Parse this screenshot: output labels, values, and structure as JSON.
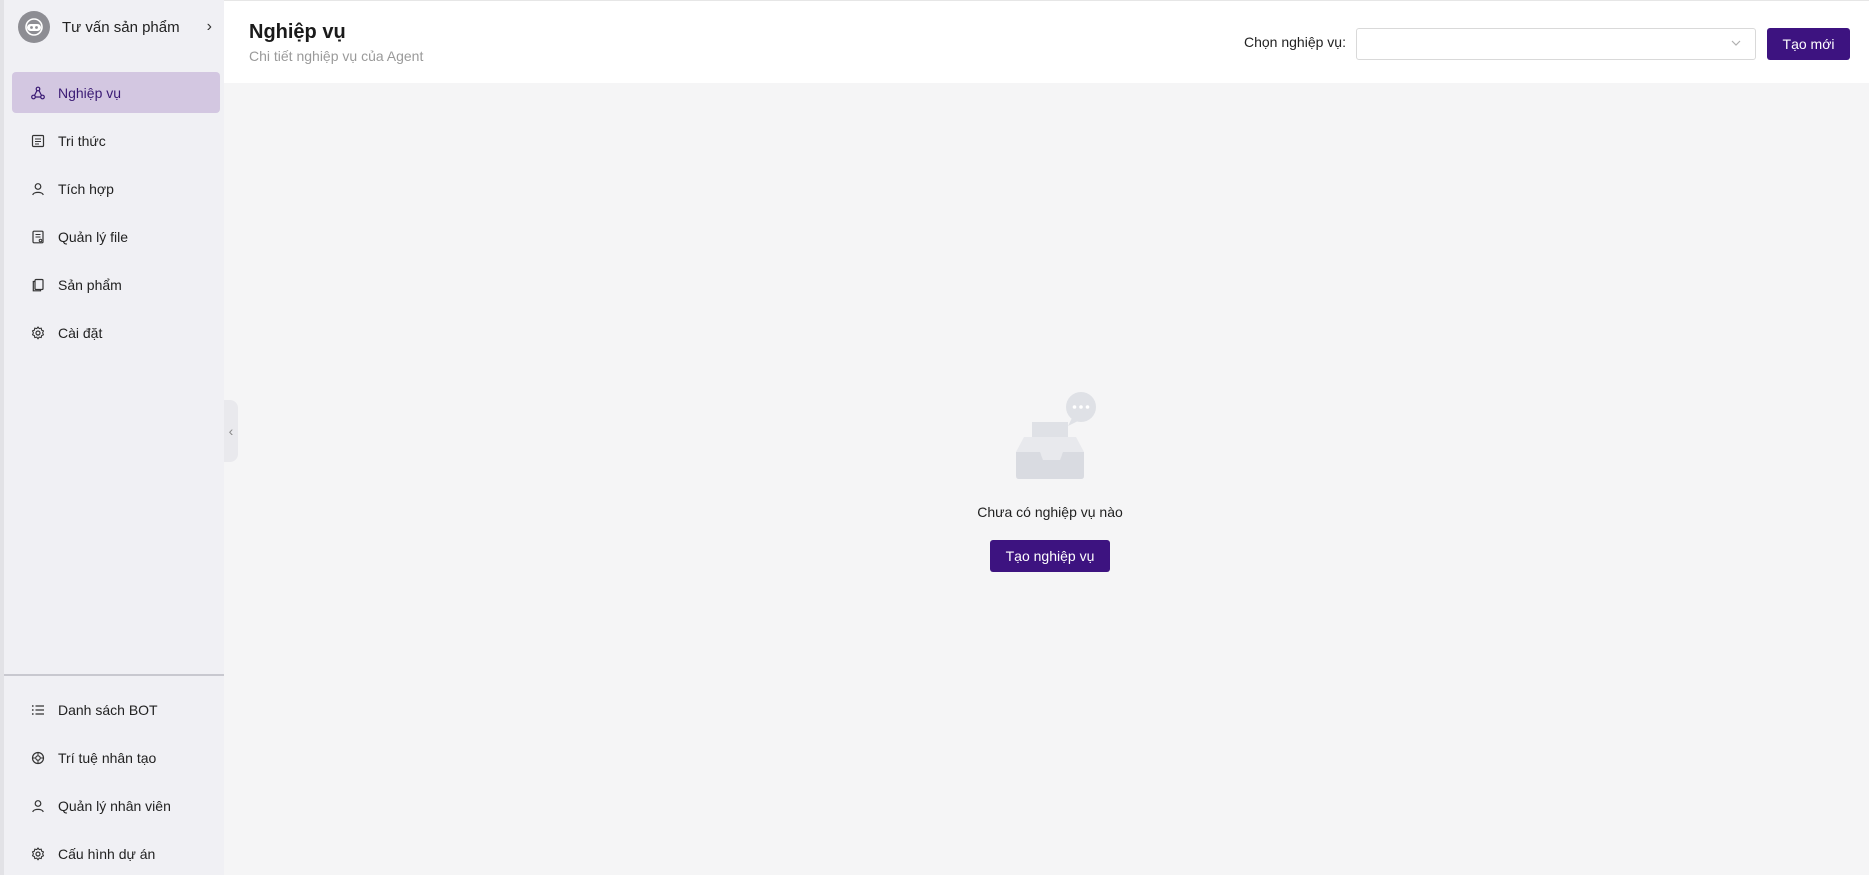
{
  "bot": {
    "name": "Tư vấn sản phẩm"
  },
  "sidebar": {
    "items": [
      {
        "label": "Nghiệp vụ",
        "icon": "workflow-icon",
        "active": true
      },
      {
        "label": "Tri thức",
        "icon": "book-icon"
      },
      {
        "label": "Tích hợp",
        "icon": "user-icon"
      },
      {
        "label": "Quản lý file",
        "icon": "file-icon"
      },
      {
        "label": "Sản phẩm",
        "icon": "copy-icon"
      },
      {
        "label": "Cài đặt",
        "icon": "gear-icon"
      }
    ],
    "bottom_items": [
      {
        "label": "Danh sách BOT",
        "icon": "list-icon"
      },
      {
        "label": "Trí tuệ nhân tạo",
        "icon": "ai-icon"
      },
      {
        "label": "Quản lý nhân viên",
        "icon": "user-icon"
      },
      {
        "label": "Cấu hình dự án",
        "icon": "gear-icon"
      }
    ]
  },
  "header": {
    "title": "Nghiệp vụ",
    "subtitle": "Chi tiết nghiệp vụ của Agent",
    "select_label": "Chọn nghiệp vụ:",
    "select_value": "",
    "new_button": "Tạo mới"
  },
  "empty_state": {
    "message": "Chưa có nghiệp vụ nào",
    "button": "Tạo nghiệp vụ"
  },
  "colors": {
    "primary": "#3d1380",
    "active_bg": "#d3c7e1",
    "sidebar_bg": "#f0f0f4",
    "content_bg": "#f5f5f6"
  }
}
